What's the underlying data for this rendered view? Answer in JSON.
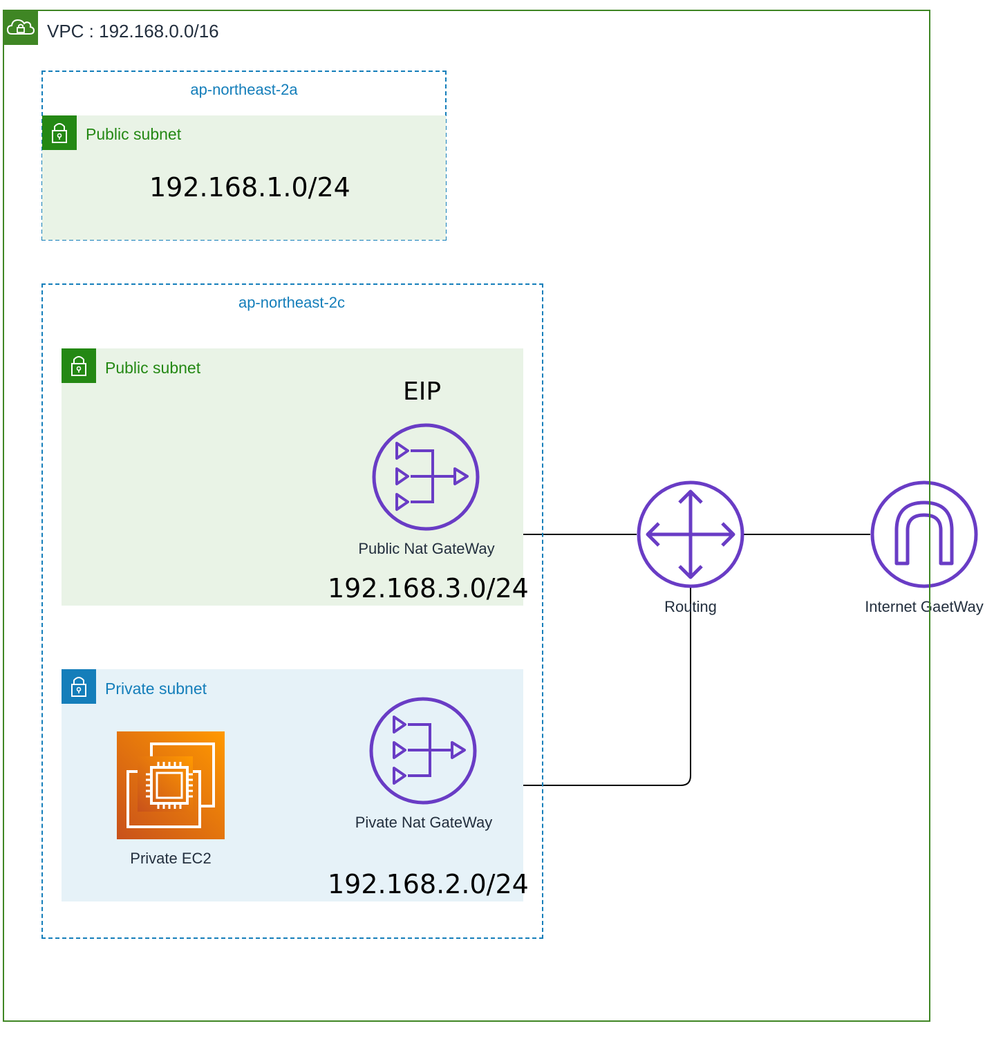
{
  "vpc": {
    "title": "VPC : 192.168.0.0/16",
    "icon": "vpc-cloud-lock-icon",
    "color": "#3f8624"
  },
  "az_a": {
    "label": "ap-northeast-2a",
    "public_subnet": {
      "label": "Public subnet",
      "cidr": "192.168.1.0/24",
      "icon": "padlock-icon",
      "color": "#248814"
    }
  },
  "az_c": {
    "label": "ap-northeast-2c",
    "public_subnet": {
      "label": "Public subnet",
      "cidr": "192.168.3.0/24",
      "eip": "EIP",
      "nat_label": "Public Nat GateWay",
      "icon": "padlock-icon",
      "color": "#248814"
    },
    "private_subnet": {
      "label": "Private subnet",
      "cidr": "192.168.2.0/24",
      "ec2_label": "Private EC2",
      "nat_label": "Pivate Nat GateWay",
      "icon": "padlock-icon",
      "color": "#147eba"
    }
  },
  "router": {
    "label": "Routing",
    "icon": "router-icon"
  },
  "igw": {
    "label": "Internet GaetWay",
    "icon": "internet-gateway-icon"
  },
  "colors": {
    "accent_purple": "#693cc5",
    "az_blue": "#147eba",
    "ec2_orange": "#ed7100"
  }
}
